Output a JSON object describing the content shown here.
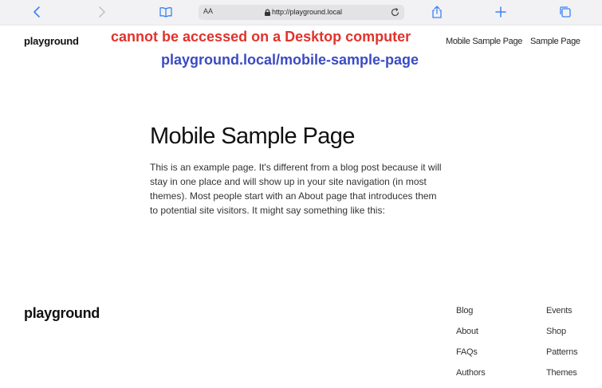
{
  "browser": {
    "address_aa": "AA",
    "url": "http://playground.local"
  },
  "site": {
    "title": "playground",
    "nav": [
      "Mobile Sample Page",
      "Sample Page"
    ]
  },
  "annotations": {
    "warning": "cannot be accessed on a Desktop computer",
    "url": "playground.local/mobile-sample-page",
    "warning_color": "#e0332c",
    "url_color": "#3a4bc4"
  },
  "main": {
    "title": "Mobile Sample Page",
    "text": "This is an example page. It's different from a blog post because it will stay in one place and will show up in your site navigation (in most themes). Most people start with an About page that introduces them to potential site visitors. It might say something like this:"
  },
  "footer": {
    "title": "playground",
    "col1": [
      "Blog",
      "About",
      "FAQs",
      "Authors"
    ],
    "col2": [
      "Events",
      "Shop",
      "Patterns",
      "Themes"
    ]
  }
}
